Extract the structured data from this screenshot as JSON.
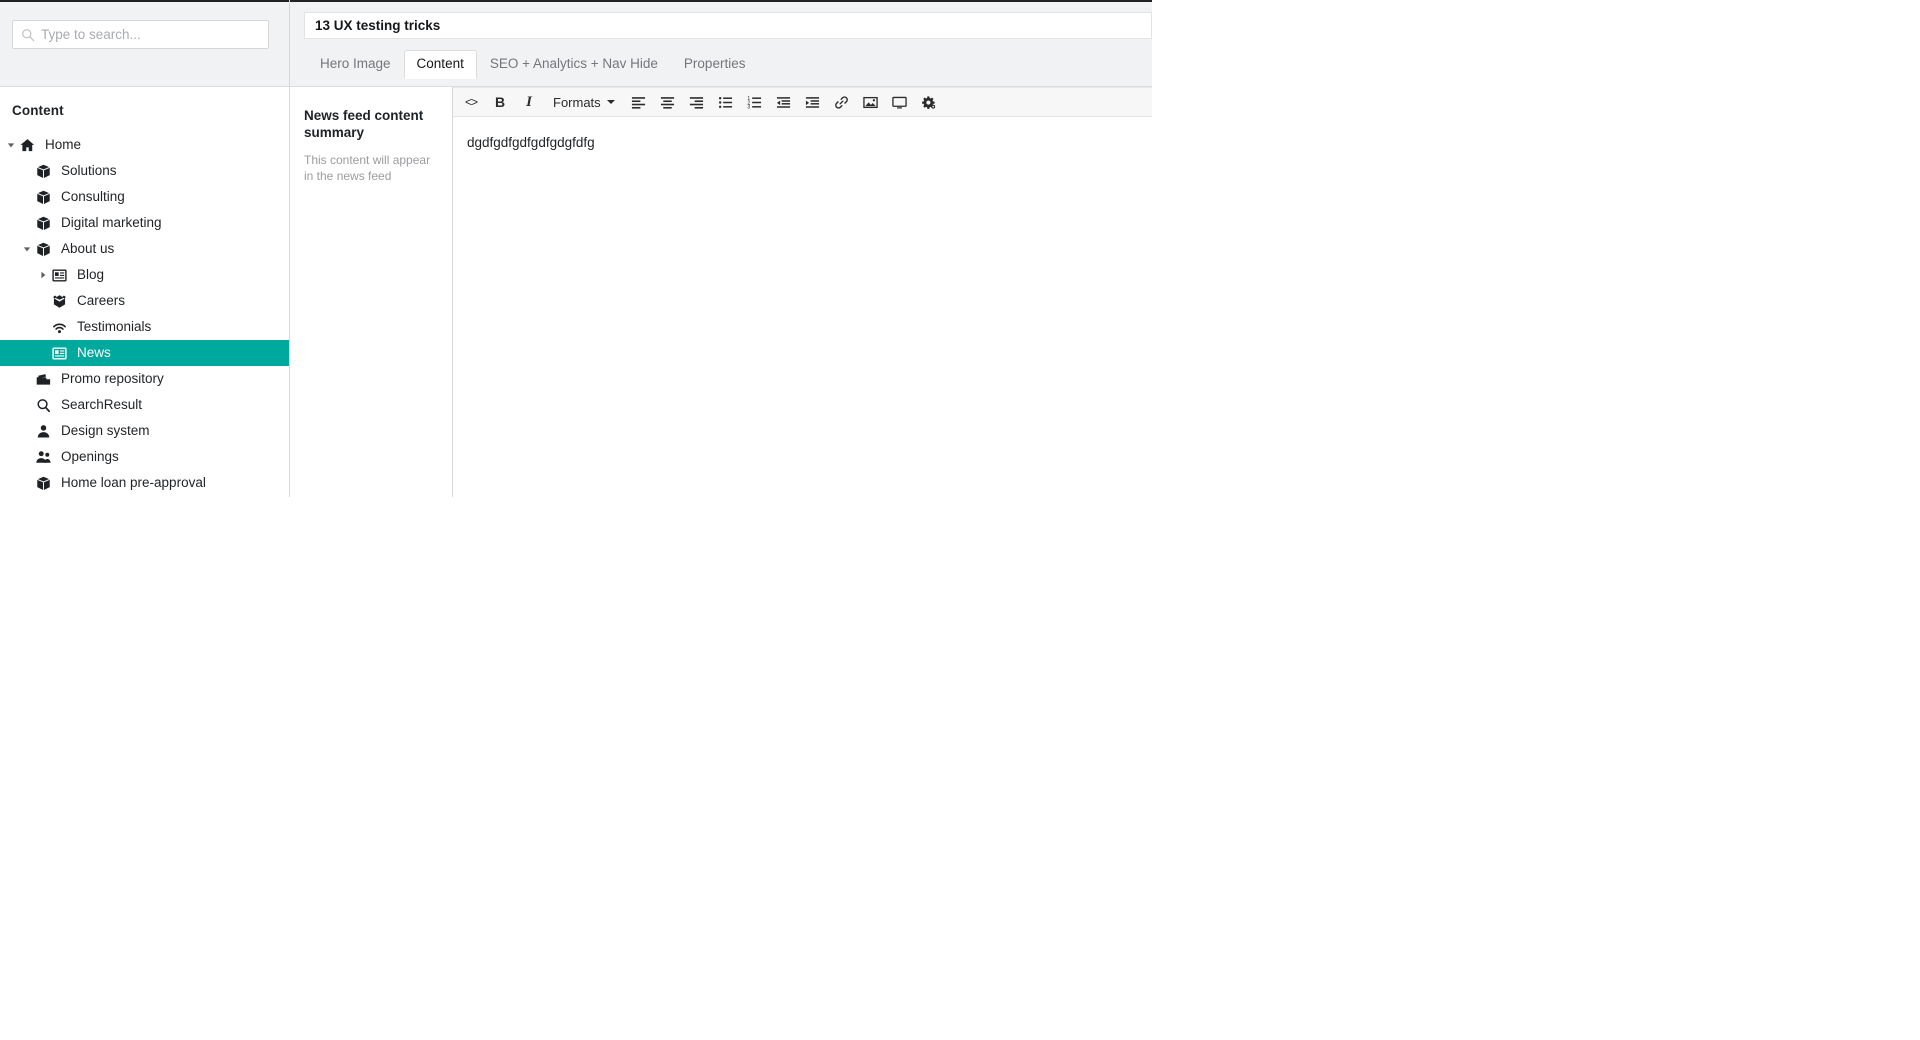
{
  "search": {
    "placeholder": "Type to search...",
    "value": "",
    "icon": "search-icon"
  },
  "sidebar": {
    "heading": "Content",
    "selected_accent_color": "#00A99D",
    "items": [
      {
        "label": "Home",
        "icon": "home-icon",
        "depth": 0,
        "twisty": "expanded",
        "selected": false
      },
      {
        "label": "Solutions",
        "icon": "package-icon",
        "depth": 1,
        "twisty": "none",
        "selected": false
      },
      {
        "label": "Consulting",
        "icon": "package-icon",
        "depth": 1,
        "twisty": "none",
        "selected": false
      },
      {
        "label": "Digital marketing",
        "icon": "package-icon",
        "depth": 1,
        "twisty": "none",
        "selected": false
      },
      {
        "label": "About us",
        "icon": "package-icon",
        "depth": 1,
        "twisty": "expanded",
        "selected": false
      },
      {
        "label": "Blog",
        "icon": "newspaper-icon",
        "depth": 2,
        "twisty": "collapsed",
        "selected": false
      },
      {
        "label": "Careers",
        "icon": "open-box-icon",
        "depth": 2,
        "twisty": "none",
        "selected": false
      },
      {
        "label": "Testimonials",
        "icon": "broadcast-icon",
        "depth": 2,
        "twisty": "none",
        "selected": false
      },
      {
        "label": "News",
        "icon": "newspaper-icon",
        "depth": 2,
        "twisty": "none",
        "selected": true
      },
      {
        "label": "Promo repository",
        "icon": "media-folder-icon",
        "depth": 1,
        "twisty": "none",
        "selected": false
      },
      {
        "label": "SearchResult",
        "icon": "magnifier-icon",
        "depth": 1,
        "twisty": "none",
        "selected": false
      },
      {
        "label": "Design system",
        "icon": "person-icon",
        "depth": 1,
        "twisty": "none",
        "selected": false
      },
      {
        "label": "Openings",
        "icon": "people-icon",
        "depth": 1,
        "twisty": "none",
        "selected": false
      },
      {
        "label": "Home loan pre-approval",
        "icon": "package-icon",
        "depth": 1,
        "twisty": "none",
        "selected": false
      }
    ]
  },
  "main": {
    "page_title_value": "13 UX testing tricks",
    "tabs": [
      {
        "label": "Hero Image",
        "active": false
      },
      {
        "label": "Content",
        "active": true
      },
      {
        "label": "SEO + Analytics + Nav Hide",
        "active": false
      },
      {
        "label": "Properties",
        "active": false
      }
    ],
    "field": {
      "label": "News feed content summary",
      "help": "This content will appear in the news feed"
    },
    "editor": {
      "toolbar": [
        {
          "name": "source-code-button",
          "label": "<>",
          "type": "text"
        },
        {
          "name": "bold-button",
          "label": "B",
          "type": "text"
        },
        {
          "name": "italic-button",
          "label": "I",
          "type": "text"
        },
        {
          "name": "formats-dropdown",
          "label": "Formats",
          "type": "dropdown"
        },
        {
          "name": "align-left-button",
          "label": "",
          "type": "icon",
          "icon": "align-left-icon"
        },
        {
          "name": "align-center-button",
          "label": "",
          "type": "icon",
          "icon": "align-center-icon"
        },
        {
          "name": "align-right-button",
          "label": "",
          "type": "icon",
          "icon": "align-right-icon"
        },
        {
          "name": "bullet-list-button",
          "label": "",
          "type": "icon",
          "icon": "bullet-list-icon"
        },
        {
          "name": "numbered-list-button",
          "label": "",
          "type": "icon",
          "icon": "numbered-list-icon"
        },
        {
          "name": "outdent-button",
          "label": "",
          "type": "icon",
          "icon": "outdent-icon"
        },
        {
          "name": "indent-button",
          "label": "",
          "type": "icon",
          "icon": "indent-icon"
        },
        {
          "name": "insert-link-button",
          "label": "",
          "type": "icon",
          "icon": "link-icon"
        },
        {
          "name": "insert-image-button",
          "label": "",
          "type": "icon",
          "icon": "image-icon"
        },
        {
          "name": "insert-media-button",
          "label": "",
          "type": "icon",
          "icon": "monitor-icon"
        },
        {
          "name": "settings-button",
          "label": "",
          "type": "icon",
          "icon": "gear-icon"
        }
      ],
      "body_text": "dgdfgdfgdfgdfgdgfdfg"
    }
  }
}
